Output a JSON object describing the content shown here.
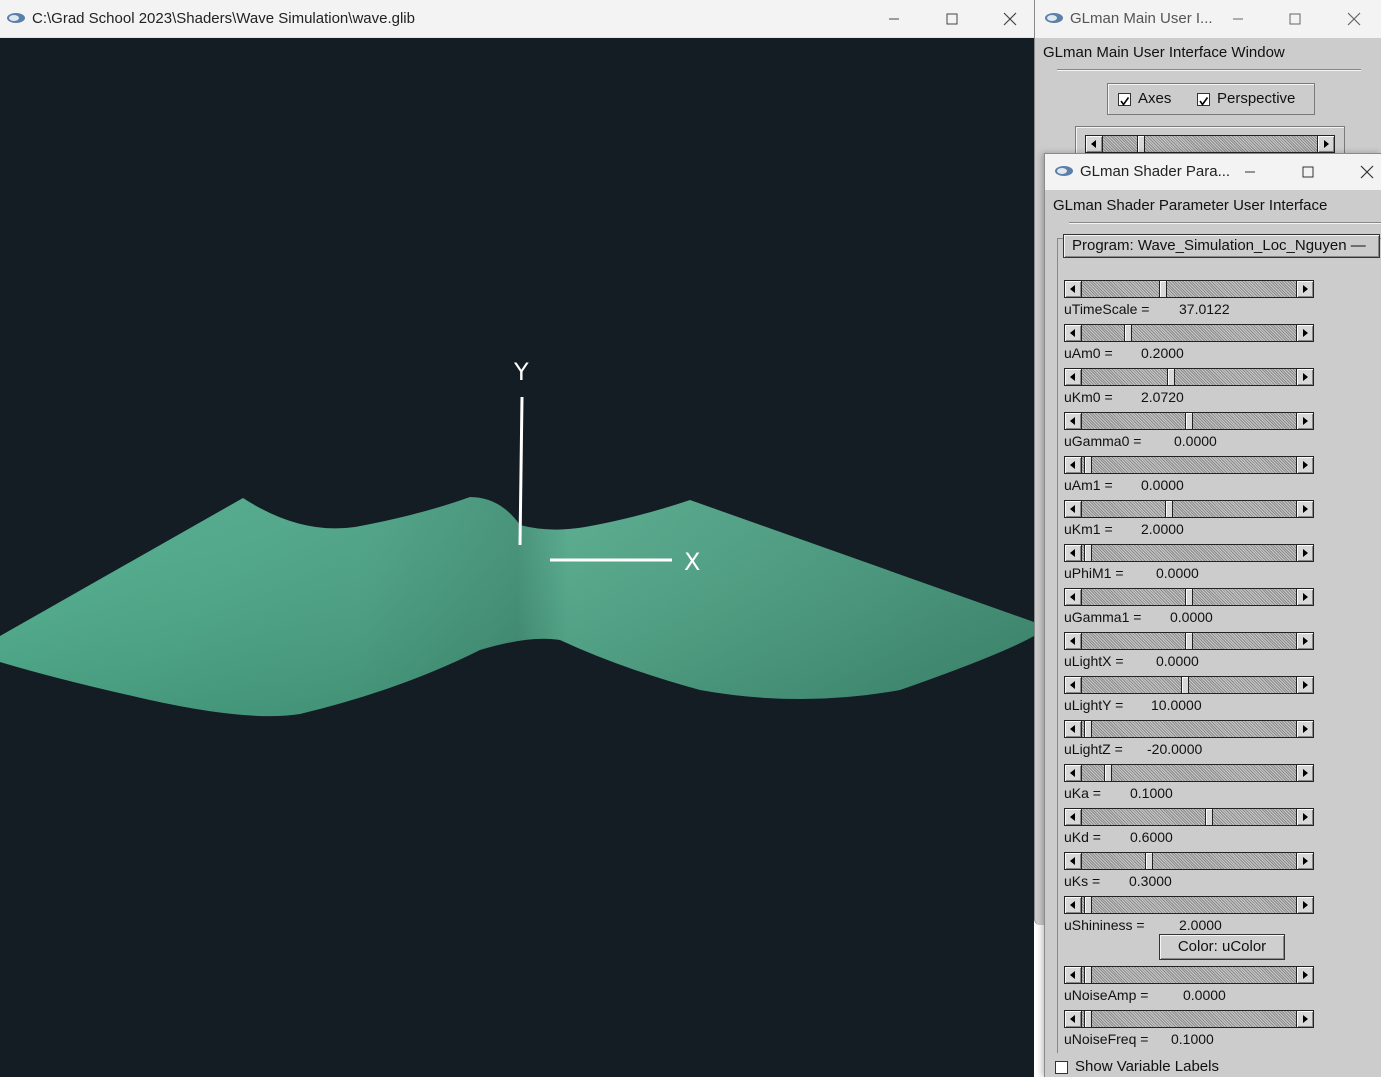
{
  "graphics_window": {
    "title": "C:\\Grad School 2023\\Shaders\\Wave Simulation\\wave.glib",
    "axis_y_label": "Y",
    "axis_x_label": "X",
    "surface_color": "#4fa98a",
    "background_color": "#141c24"
  },
  "main_ui": {
    "title": "GLman Main User I...",
    "heading": "GLman Main User Interface Window",
    "axes_label": "Axes",
    "axes_checked": true,
    "perspective_label": "Perspective",
    "perspective_checked": true,
    "slider_fraction": 0.16
  },
  "shader_ui": {
    "title": "GLman Shader Para...",
    "heading": "GLman Shader Parameter User Interface",
    "program_label": "Program: Wave_Simulation_Loc_Nguyen —",
    "color_button": "Color: uColor",
    "show_labels": "Show Variable Labels",
    "show_labels_checked": false,
    "params": [
      {
        "label": "uTimeScale =",
        "value": "37.0122",
        "fraction": 0.37
      },
      {
        "label": "uAm0 =",
        "value": "0.2000",
        "fraction": 0.2
      },
      {
        "label": "uKm0 =",
        "value": "2.0720",
        "fraction": 0.41
      },
      {
        "label": "uGamma0 =",
        "value": "0.0000",
        "fraction": 0.5
      },
      {
        "label": "uAm1 =",
        "value": "0.0000",
        "fraction": 0.0
      },
      {
        "label": "uKm1 =",
        "value": "2.0000",
        "fraction": 0.4
      },
      {
        "label": "uPhiM1 =",
        "value": "0.0000",
        "fraction": 0.0
      },
      {
        "label": "uGamma1 =",
        "value": "0.0000",
        "fraction": 0.5
      },
      {
        "label": "uLightX =",
        "value": "0.0000",
        "fraction": 0.5
      },
      {
        "label": "uLightY =",
        "value": "10.0000",
        "fraction": 0.48
      },
      {
        "label": "uLightZ =",
        "value": "-20.0000",
        "fraction": 0.0
      },
      {
        "label": "uKa =",
        "value": "0.1000",
        "fraction": 0.1
      },
      {
        "label": "uKd =",
        "value": "0.6000",
        "fraction": 0.6
      },
      {
        "label": "uKs =",
        "value": "0.3000",
        "fraction": 0.3
      },
      {
        "label": "uShininess =",
        "value": "2.0000",
        "fraction": 0.0
      },
      {
        "label": "uNoiseAmp =",
        "value": "0.0000",
        "fraction": 0.0
      },
      {
        "label": "uNoiseFreq =",
        "value": "0.1000",
        "fraction": 0.0
      }
    ]
  }
}
